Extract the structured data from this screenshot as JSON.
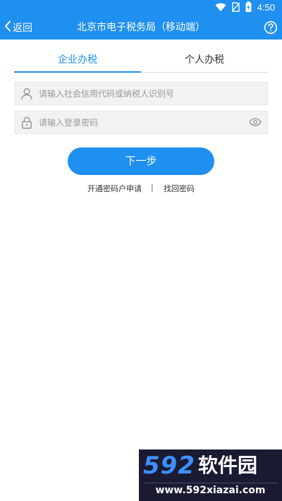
{
  "status_bar": {
    "time": "4:50"
  },
  "header": {
    "back_label": "返回",
    "title": "北京市电子税务局（移动端）"
  },
  "tabs": [
    {
      "label": "企业办税",
      "active": true
    },
    {
      "label": "个人办税",
      "active": false
    }
  ],
  "form": {
    "id_placeholder": "请输入社会信用代码或纳税人识别号",
    "password_placeholder": "请输入登录密码",
    "next_label": "下一步"
  },
  "links": {
    "register_label": "开通密码户申请",
    "separator": "|",
    "forgot_label": "找回密码"
  },
  "watermark": {
    "brand_number": "592",
    "brand_text": "软件园",
    "url": "www.592xiazai.com"
  },
  "colors": {
    "primary": "#1f8ff0",
    "field_bg": "#f2f2f2",
    "watermark_bg": "#1a1b33"
  },
  "icons": [
    "wifi-icon",
    "no-sim-icon",
    "battery-icon",
    "back-chevron-icon",
    "help-icon",
    "user-icon",
    "lock-icon",
    "eye-icon"
  ]
}
